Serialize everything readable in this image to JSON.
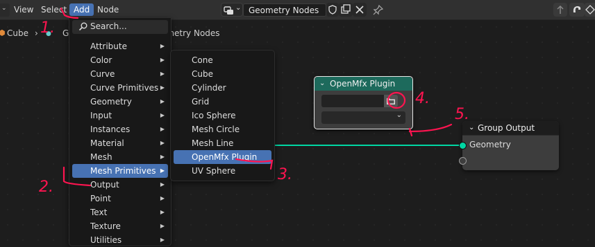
{
  "header": {
    "menus": [
      "View",
      "Select",
      "Add",
      "Node"
    ],
    "node_tree_name": "Geometry Nodes"
  },
  "breadcrumb": {
    "object": "Cube",
    "partial": "G",
    "tree": "ometry Nodes"
  },
  "add_menu": {
    "search": "Search...",
    "items": [
      "Attribute",
      "Color",
      "Curve",
      "Curve Primitives",
      "Geometry",
      "Input",
      "Instances",
      "Material",
      "Mesh",
      "Mesh Primitives",
      "Output",
      "Point",
      "Text",
      "Texture",
      "Utilities"
    ],
    "highlighted": "Mesh Primitives"
  },
  "mesh_primitives_menu": {
    "items": [
      "Cone",
      "Cube",
      "Cylinder",
      "Grid",
      "Ico Sphere",
      "Mesh Circle",
      "Mesh Line",
      "OpenMfx Plugin",
      "UV Sphere"
    ],
    "highlighted": "OpenMfx Plugin"
  },
  "openmfx_node": {
    "title": "OpenMfx Plugin",
    "file_path_value": "",
    "dropdown_value": ""
  },
  "group_output_node": {
    "title": "Group Output",
    "socket_label": "Geometry"
  },
  "annotations": [
    "1.",
    "2.",
    "3.",
    "4.",
    "5."
  ],
  "colors": {
    "highlight": "#4772b3",
    "openmfx_header": "#1d6a5c",
    "group_output_header": "#1d1d1d",
    "geometry_socket": "#00d6a3",
    "annotation": "#ff1450"
  }
}
